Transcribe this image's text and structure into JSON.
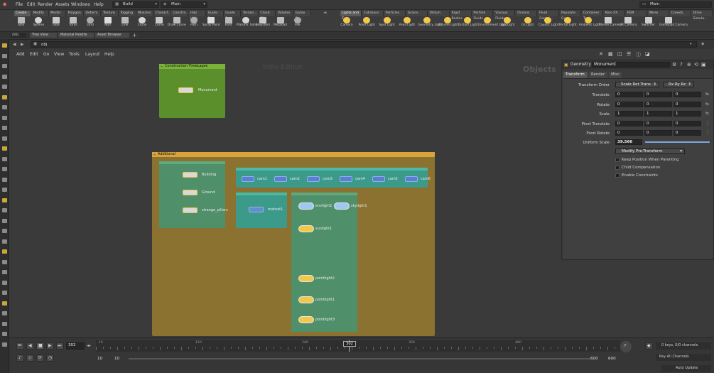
{
  "menubar": {
    "items": [
      "File",
      "Edit",
      "Render",
      "Assets",
      "Windows",
      "Help"
    ],
    "desktop": "Build",
    "pane_link": "Main",
    "right_main": "Main"
  },
  "shelf": {
    "left_tabs": [
      "Create",
      "Modify",
      "Model",
      "Polygon",
      "Deform",
      "Texture",
      "Rigging",
      "Muscles",
      "Charact...",
      "Constra...",
      "Hair Utils",
      "Guide P...",
      "Guide B...",
      "Terrain...",
      "Cloud FX",
      "Volume",
      "Game De..."
    ],
    "left_active": "Create",
    "left_tools": [
      "Box",
      "Sphere",
      "Tube",
      "Torus",
      "Grid",
      "Null",
      "Line",
      "Circle",
      "Curve",
      "Draw Curve",
      "Path",
      "Spray Paint",
      "Font",
      "Platonic Solids",
      "L-System",
      "Metaball",
      "File"
    ],
    "right_tabs": [
      "Lights and C...",
      "Collisions",
      "Particles",
      "Grains",
      "Vellum",
      "Rigid Bodies",
      "Particle Fluids",
      "Viscous Fluids",
      "Oceans",
      "Fluid Contai...",
      "Populate Con...",
      "Container Tools",
      "Pyro FX",
      "FEM",
      "Wires",
      "Crowds",
      "Drive Simula..."
    ],
    "right_active": "Lights and C...",
    "right_tools": [
      "Camera",
      "Point Light",
      "Spot Light",
      "Area Light",
      "Geometry Light",
      "Volume Light",
      "Distant Light",
      "Environment Light",
      "Sky Light",
      "GI Light",
      "Caustic Light",
      "Portal Light",
      "Ambient Light",
      "Stereo Camera",
      "VR Camera",
      "Switcher",
      "Gamepad Camera"
    ]
  },
  "toolbar2": {
    "context": "/obj",
    "tabs": [
      "Tree View",
      "Material Palette",
      "Asset Browser"
    ]
  },
  "path": {
    "value": "obj"
  },
  "network": {
    "menu": [
      "Add",
      "Edit",
      "Go",
      "View",
      "Tools",
      "Layout",
      "Help"
    ],
    "edition_watermark": "Indie Edition",
    "context_watermark": "Objects",
    "boxes": {
      "construction": {
        "title": "Construction TimeLapse",
        "nodes": [
          "Monument"
        ]
      },
      "additional": {
        "title": "Additional"
      },
      "geo": {
        "nodes": [
          "Building",
          "Ground",
          "strange_pillars"
        ]
      },
      "cams": {
        "nodes": [
          "cam1",
          "cam2",
          "cam3",
          "cam4",
          "cam5",
          "cam6"
        ]
      },
      "matnet": {
        "nodes": [
          "matnet1"
        ]
      },
      "lights": {
        "nodes": [
          "envlight1",
          "skylight1",
          "sunlight1",
          "pointlight2",
          "pointlight1",
          "pointlight3"
        ]
      }
    }
  },
  "params": {
    "node_type": "Geometry",
    "node_name": "Monument",
    "tabs": [
      "Transform",
      "Render",
      "Misc"
    ],
    "active_tab": "Transform",
    "transform_order": "Scale Rot Trans",
    "rotate_order": "Rx Ry Rz",
    "rows": [
      {
        "label": "Translate",
        "values": [
          "0",
          "0",
          "0"
        ]
      },
      {
        "label": "Rotate",
        "values": [
          "0",
          "0",
          "0"
        ]
      },
      {
        "label": "Scale",
        "values": [
          "1",
          "1",
          "1"
        ]
      },
      {
        "label": "Pivot Translate",
        "values": [
          "0",
          "0",
          "0"
        ]
      },
      {
        "label": "Pivot Rotate",
        "values": [
          "0",
          "0",
          "0"
        ]
      }
    ],
    "transform_order_label": "Transform Order",
    "uniform_scale_label": "Uniform Scale",
    "uniform_scale": "39.566",
    "uniform_scale_fraction": 0.99,
    "modify_pretransform": "Modify Pre-Transform",
    "checkboxes": [
      "Keep Position When Parenting",
      "Child Compensation",
      "Enable Constraints"
    ]
  },
  "timeline": {
    "current_frame": "302",
    "ruler_marks": [
      "10",
      "120",
      "240",
      "302",
      "360",
      "480"
    ],
    "start": "10",
    "start2": "10",
    "end": "600",
    "end2": "600",
    "keys_info": "0 keys, 0/0 channels",
    "key_all": "Key All Channels",
    "auto_update": "Auto Update"
  },
  "colors": {
    "construction_box": "#5b8f2c",
    "additional_box": "#8b7230",
    "green_subnet": "#4f8f6a",
    "cam_subnet": "#3b9a8a"
  }
}
